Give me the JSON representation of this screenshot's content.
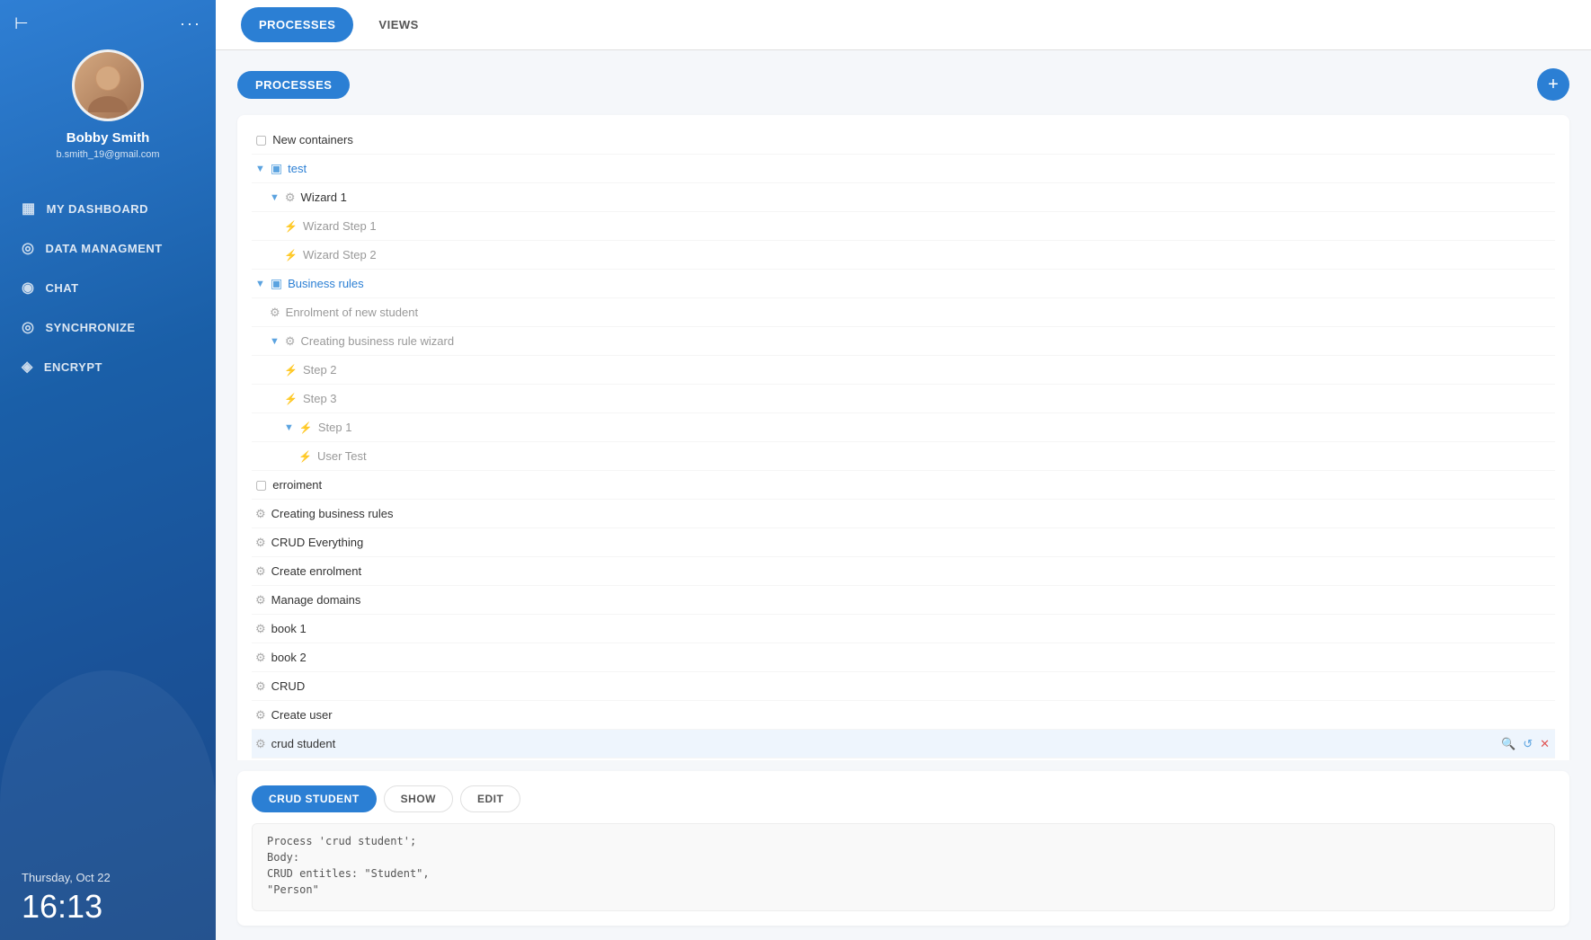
{
  "sidebar": {
    "top_icon": "⊢",
    "dots": "···",
    "profile": {
      "name": "Bobby Smith",
      "email": "b.smith_19@gmail.com"
    },
    "nav_items": [
      {
        "id": "dashboard",
        "label": "MY DASHBOARD",
        "icon": "▦"
      },
      {
        "id": "data",
        "label": "DATA MANAGMENT",
        "icon": "◎"
      },
      {
        "id": "chat",
        "label": "CHAT",
        "icon": "◉"
      },
      {
        "id": "sync",
        "label": "SYNCHRONIZE",
        "icon": "◎"
      },
      {
        "id": "encrypt",
        "label": "ENCRYPT",
        "icon": "◈"
      }
    ],
    "date": "Thursday, Oct 22",
    "time": "16:13"
  },
  "tabs": [
    {
      "id": "processes",
      "label": "PROCESSES",
      "active": true
    },
    {
      "id": "views",
      "label": "VIEWS",
      "active": false
    }
  ],
  "processes_section": {
    "button_label": "PROCESSES",
    "add_label": "+"
  },
  "tree": [
    {
      "id": "new-containers",
      "label": "New containers",
      "type": "folder-grey",
      "indent": 0,
      "expanded": false
    },
    {
      "id": "test",
      "label": "test",
      "type": "folder-blue",
      "indent": 0,
      "expanded": true
    },
    {
      "id": "wizard-1",
      "label": "Wizard 1",
      "type": "process",
      "indent": 1,
      "expanded": true
    },
    {
      "id": "wizard-step-1",
      "label": "Wizard Step 1",
      "type": "lightning",
      "indent": 2
    },
    {
      "id": "wizard-step-2",
      "label": "Wizard Step 2",
      "type": "lightning",
      "indent": 2
    },
    {
      "id": "business-rules",
      "label": "Business rules",
      "type": "folder-blue",
      "indent": 0,
      "expanded": true
    },
    {
      "id": "enrolment-new-student",
      "label": "Enrolment of new student",
      "type": "process",
      "indent": 1
    },
    {
      "id": "creating-business-rule-wizard",
      "label": "Creating business rule wizard",
      "type": "process",
      "indent": 1,
      "expanded": true
    },
    {
      "id": "step-2",
      "label": "Step 2",
      "type": "lightning",
      "indent": 2
    },
    {
      "id": "step-3",
      "label": "Step 3",
      "type": "lightning",
      "indent": 2
    },
    {
      "id": "step-1",
      "label": "Step 1",
      "type": "lightning",
      "indent": 2,
      "expanded": true
    },
    {
      "id": "user-test",
      "label": "User Test",
      "type": "lightning",
      "indent": 3
    },
    {
      "id": "erroiment",
      "label": "erroiment",
      "type": "folder-grey",
      "indent": 0
    },
    {
      "id": "creating-business-rules",
      "label": "Creating business rules",
      "type": "process",
      "indent": 0
    },
    {
      "id": "crud-everything",
      "label": "CRUD Everything",
      "type": "process",
      "indent": 0
    },
    {
      "id": "create-enrolment",
      "label": "Create enrolment",
      "type": "process",
      "indent": 0
    },
    {
      "id": "manage-domains",
      "label": "Manage domains",
      "type": "process",
      "indent": 0
    },
    {
      "id": "book-1",
      "label": "book 1",
      "type": "process",
      "indent": 0
    },
    {
      "id": "book-2",
      "label": "book 2",
      "type": "process",
      "indent": 0
    },
    {
      "id": "crud",
      "label": "CRUD",
      "type": "process",
      "indent": 0
    },
    {
      "id": "create-user",
      "label": "Create user",
      "type": "process",
      "indent": 0
    },
    {
      "id": "crud-student",
      "label": "crud student",
      "type": "process",
      "indent": 0
    }
  ],
  "bottom_panel": {
    "title_label": "CRUD STUDENT",
    "tabs": [
      {
        "id": "show",
        "label": "SHOW",
        "active": false
      },
      {
        "id": "edit",
        "label": "EDIT",
        "active": false
      }
    ],
    "code_line1": "Process 'crud student';",
    "code_line2": "Body:",
    "code_line3": "CRUD entitles: \"Student\",",
    "code_line4": "\"Person\""
  }
}
